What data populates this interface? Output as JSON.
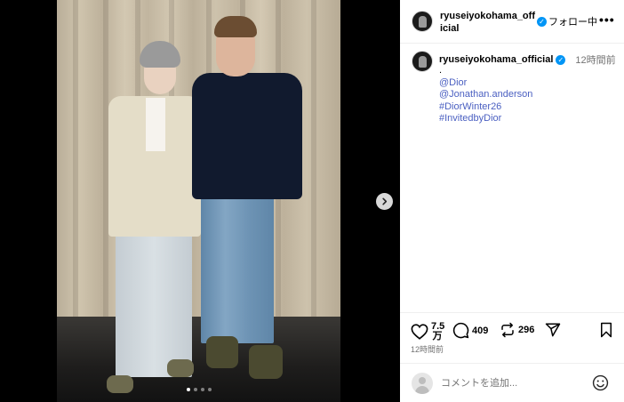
{
  "post": {
    "username": "ryuseiyokohama_official",
    "follow_state": "フォロー中",
    "more_label": "•••",
    "media_dots": 4,
    "active_dot": 0
  },
  "caption": {
    "username": "ryuseiyokohama_official",
    "time": "12時間前",
    "first_line": ".",
    "lines": [
      "@Dior",
      "@Jonathan.anderson",
      "#DiorWinter26",
      "#InvitedbyDior"
    ]
  },
  "actions": {
    "likes": "7.5\n万",
    "likes_top": "7.5",
    "likes_bottom": "万",
    "comments": "409",
    "reposts": "296"
  },
  "post_time": "12時間前",
  "comment_box": {
    "placeholder": "コメントを追加..."
  },
  "colors": {
    "verified": "#0095f6",
    "link": "#4a5fc1",
    "muted": "#737373"
  }
}
